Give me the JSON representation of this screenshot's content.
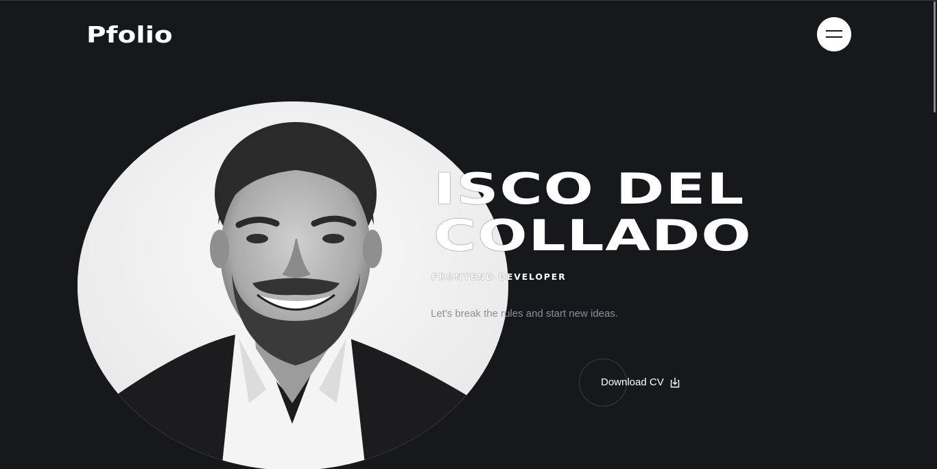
{
  "brand": {
    "logo_text": "Pfolio"
  },
  "header": {
    "menu_icon": "hamburger-menu-icon"
  },
  "hero": {
    "name_line_1": "ISCO DEL",
    "name_line_2": "COLLADO",
    "role": "FRONTEND DEVELOPER",
    "tagline": "Let's break the rules and start new ideas.",
    "cta_label": "Download CV",
    "cta_icon": "download-icon",
    "photo": "portrait-photo"
  },
  "colors": {
    "background": "#17181c",
    "text": "#ffffff",
    "muted_text": "#8e8f96",
    "ring": "#3b3c42"
  }
}
